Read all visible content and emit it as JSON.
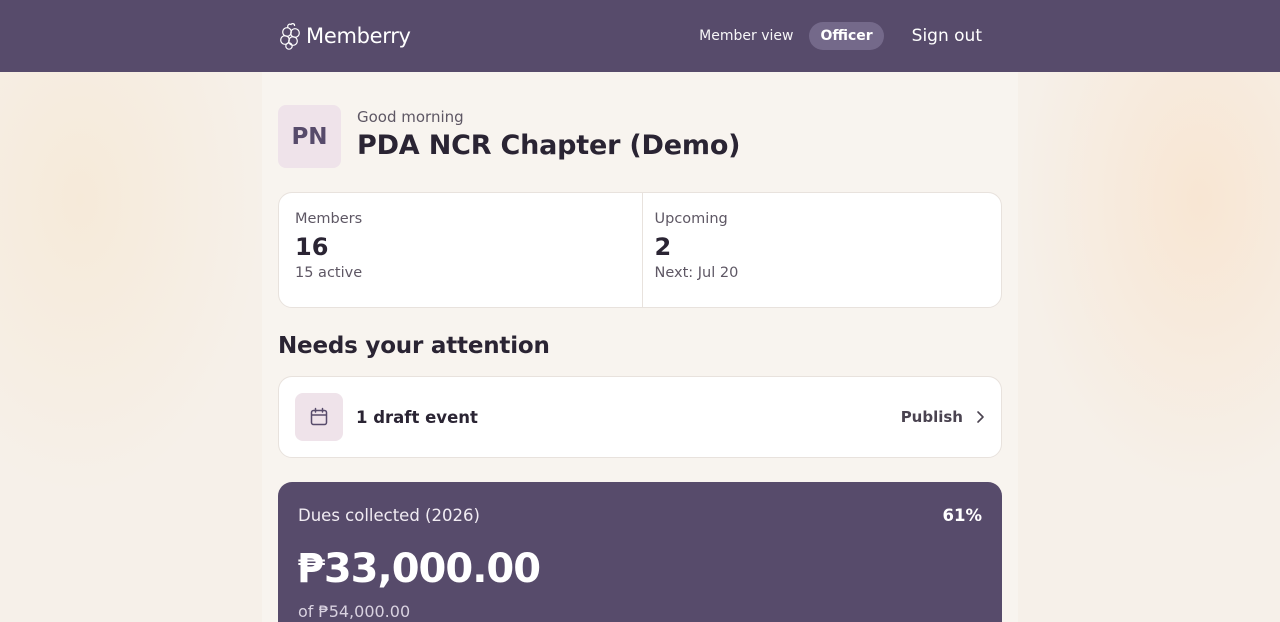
{
  "header": {
    "brand": "Memberry",
    "nav_member_view": "Member view",
    "nav_officer": "Officer",
    "sign_out": "Sign out",
    "color": "#574b6b"
  },
  "profile": {
    "initials": "PN",
    "greeting": "Good morning",
    "org_name": "PDA NCR Chapter (Demo)"
  },
  "stats": [
    {
      "label": "Members",
      "value": "16",
      "sub": "15 active"
    },
    {
      "label": "Upcoming",
      "value": "2",
      "sub": "Next: Jul 20"
    }
  ],
  "attention": {
    "title": "Needs your attention",
    "items": [
      {
        "icon": "calendar-icon",
        "text": "1 draft event",
        "action": "Publish"
      }
    ]
  },
  "dues": {
    "label": "Dues collected (2026)",
    "percent": "61%",
    "percent_value": 61,
    "amount": "₱33,000.00",
    "target": "of ₱54,000.00"
  }
}
